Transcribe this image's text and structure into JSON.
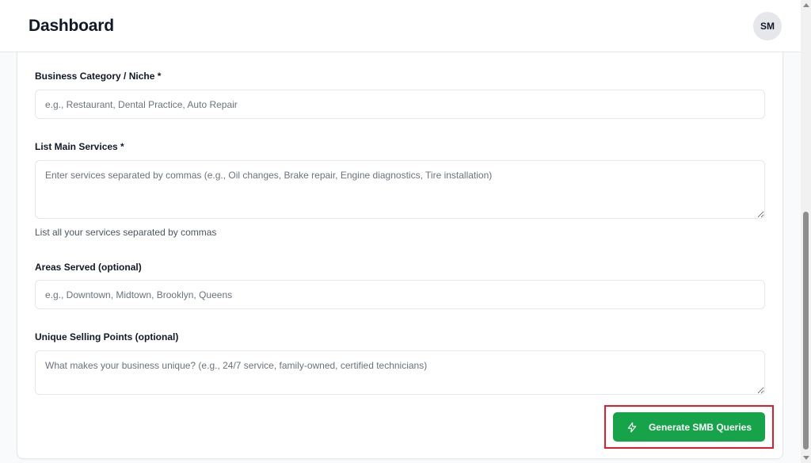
{
  "header": {
    "title": "Dashboard",
    "avatar_initials": "SM"
  },
  "form": {
    "category": {
      "label": "Business Category / Niche *",
      "placeholder": "e.g., Restaurant, Dental Practice, Auto Repair",
      "value": ""
    },
    "services": {
      "label": "List Main Services *",
      "placeholder": "Enter services separated by commas (e.g., Oil changes, Brake repair, Engine diagnostics, Tire installation)",
      "value": "",
      "hint": "List all your services separated by commas"
    },
    "areas": {
      "label": "Areas Served (optional)",
      "placeholder": "e.g., Downtown, Midtown, Brooklyn, Queens",
      "value": ""
    },
    "usp": {
      "label": "Unique Selling Points (optional)",
      "placeholder": "What makes your business unique? (e.g., 24/7 service, family-owned, certified technicians)",
      "value": ""
    },
    "submit": {
      "label": "Generate SMB Queries",
      "icon": "lightning-icon"
    }
  },
  "colors": {
    "primary_green": "#16a34a",
    "highlight_red": "#e11d2a"
  }
}
